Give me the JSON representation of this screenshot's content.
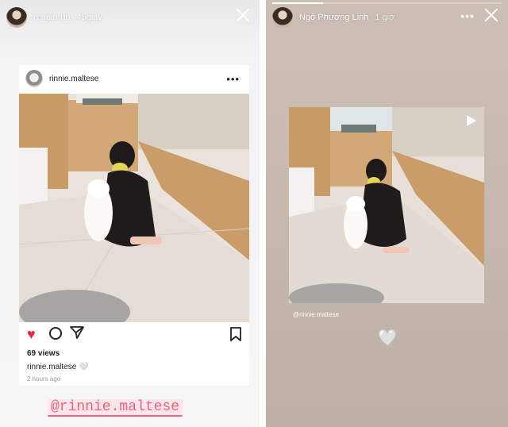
{
  "left_story": {
    "username": "runpiprun",
    "time": "45giây",
    "card": {
      "account": "rinnie.maltese",
      "more": "•••",
      "views": "69 views",
      "caption_user": "rinnie.maltese",
      "caption_emoji": "🤍",
      "time_ago": "2 hours ago"
    },
    "mention": "@rinnie.maltese"
  },
  "right_story": {
    "username": "Ngô Phương Linh",
    "time": "1 giờ",
    "more": "•••",
    "progress": 0.22,
    "tag": "@rinnie.maltese",
    "heart": "🤍"
  },
  "icons": {
    "heart": "♥",
    "close": "close-icon",
    "comment": "comment-icon",
    "send": "send-icon",
    "bookmark": "bookmark-icon",
    "play": "play-icon"
  },
  "colors": {
    "heart_red": "#e62a3d",
    "mention_pink": "#f1637a",
    "story_bg_right": "#c5b8ae"
  }
}
